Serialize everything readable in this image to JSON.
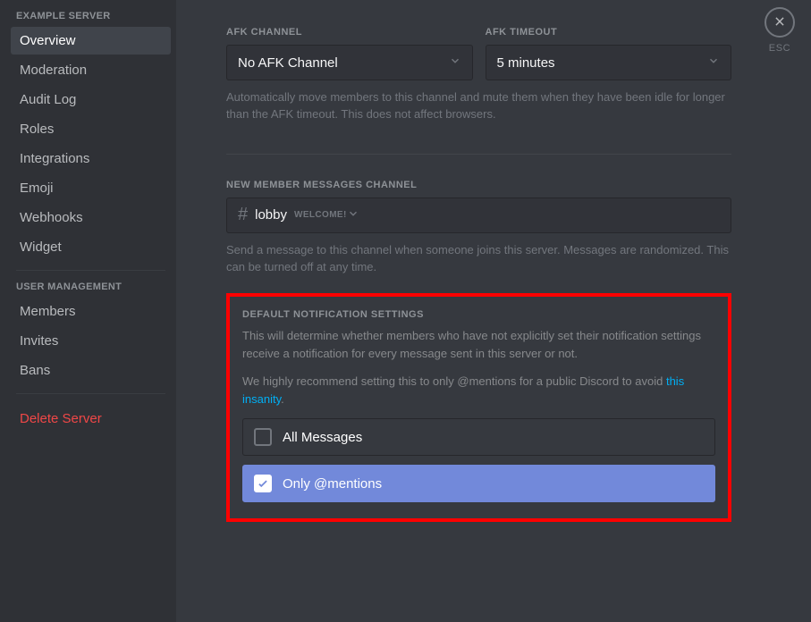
{
  "close": {
    "esc": "ESC"
  },
  "sidebar": {
    "heading_server": "EXAMPLE SERVER",
    "items": [
      {
        "label": "Overview"
      },
      {
        "label": "Moderation"
      },
      {
        "label": "Audit Log"
      },
      {
        "label": "Roles"
      },
      {
        "label": "Integrations"
      },
      {
        "label": "Emoji"
      },
      {
        "label": "Webhooks"
      },
      {
        "label": "Widget"
      }
    ],
    "heading_user": "USER MANAGEMENT",
    "user_items": [
      {
        "label": "Members"
      },
      {
        "label": "Invites"
      },
      {
        "label": "Bans"
      }
    ],
    "delete": "Delete Server"
  },
  "afk": {
    "channel_label": "AFK CHANNEL",
    "channel_value": "No AFK Channel",
    "timeout_label": "AFK TIMEOUT",
    "timeout_value": "5 minutes",
    "helper": "Automatically move members to this channel and mute them when they have been idle for longer than the AFK timeout. This does not affect browsers."
  },
  "newmember": {
    "label": "NEW MEMBER MESSAGES CHANNEL",
    "channel": "lobby",
    "welcome": "WELCOME!",
    "helper": "Send a message to this channel when someone joins this server. Messages are randomized. This can be turned off at any time."
  },
  "notif": {
    "label": "DEFAULT NOTIFICATION SETTINGS",
    "desc1": "This will determine whether members who have not explicitly set their notification settings receive a notification for every message sent in this server or not.",
    "desc2_a": "We highly recommend setting this to only @mentions for a public Discord to avoid ",
    "desc2_link": "this insanity",
    "desc2_b": ".",
    "opt_all": "All Messages",
    "opt_mentions": "Only @mentions"
  }
}
